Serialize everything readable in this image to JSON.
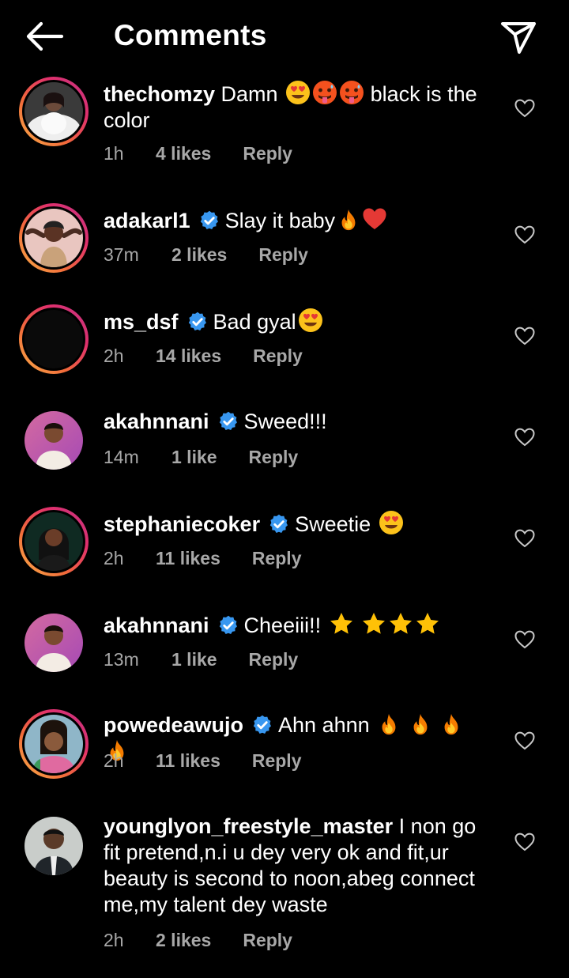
{
  "header": {
    "title": "Comments",
    "back_icon": "arrow-left-icon",
    "share_icon": "paper-plane-icon"
  },
  "colors": {
    "background": "#000000",
    "text": "#ffffff",
    "muted": "#a8a8a8",
    "verified": "#3897f0"
  },
  "comments": [
    {
      "username": "thechomzy",
      "verified": false,
      "text": "Damn",
      "text_after": "black is the color",
      "time": "1h",
      "likes": "4 likes",
      "reply": "Reply"
    },
    {
      "username": "adakarl1",
      "verified": true,
      "text": "Slay it baby",
      "time": "37m",
      "likes": "2 likes",
      "reply": "Reply"
    },
    {
      "username": "ms_dsf",
      "verified": true,
      "text": "Bad gyal",
      "time": "2h",
      "likes": "14 likes",
      "reply": "Reply"
    },
    {
      "username": "akahnnani",
      "verified": true,
      "text": "Sweed!!!",
      "time": "14m",
      "likes": "1 like",
      "reply": "Reply"
    },
    {
      "username": "stephaniecoker",
      "verified": true,
      "text": "Sweetie",
      "time": "2h",
      "likes": "11 likes",
      "reply": "Reply"
    },
    {
      "username": "akahnnani",
      "verified": true,
      "text": "Cheeiii!!",
      "time": "13m",
      "likes": "1 like",
      "reply": "Reply"
    },
    {
      "username": "powedeawujo",
      "verified": true,
      "text": "Ahn ahnn",
      "time": "2h",
      "likes": "11 likes",
      "reply": "Reply"
    },
    {
      "username": "younglyon_freestyle_master",
      "verified": false,
      "text": "I non go fit pretend,n.i u dey very ok and fit,ur beauty is second to noon,abeg connect me,my talent dey waste",
      "time": "2h",
      "likes": "2 likes",
      "reply": "Reply"
    }
  ]
}
